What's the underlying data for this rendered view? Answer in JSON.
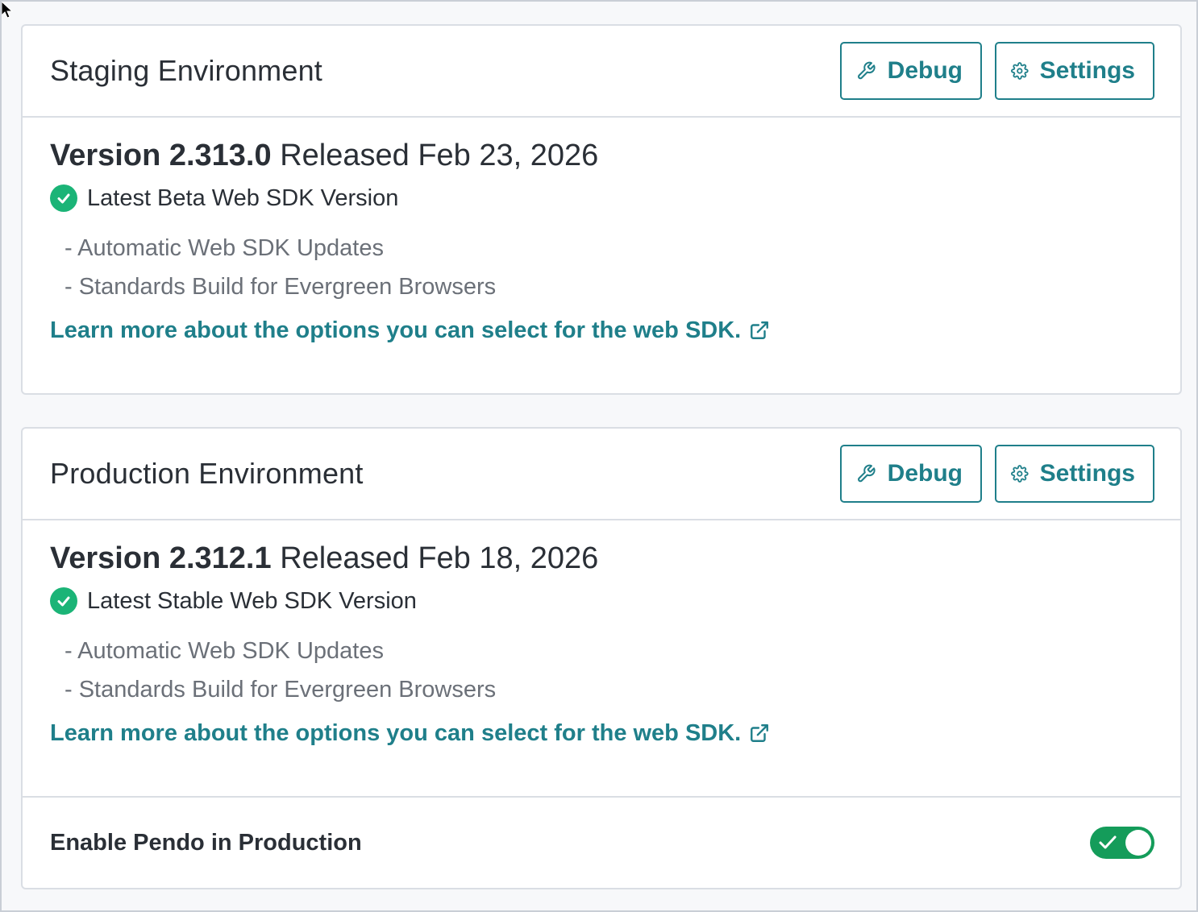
{
  "colors": {
    "accent": "#1f7f8a",
    "success": "#1bb477",
    "toggle_on": "#149c5a",
    "text_primary": "#2a2f36",
    "text_muted": "#6b7078"
  },
  "staging": {
    "title": "Staging Environment",
    "debug_label": "Debug",
    "settings_label": "Settings",
    "version": "Version 2.313.0",
    "released": "Released Feb 23, 2026",
    "status": "Latest Beta Web SDK Version",
    "features": [
      "- Automatic Web SDK Updates",
      "- Standards Build for Evergreen Browsers"
    ],
    "learn_more": "Learn more about the options you can select for the web SDK."
  },
  "production": {
    "title": "Production Environment",
    "debug_label": "Debug",
    "settings_label": "Settings",
    "version": "Version 2.312.1",
    "released": "Released Feb 18, 2026",
    "status": "Latest Stable Web SDK Version",
    "features": [
      "- Automatic Web SDK Updates",
      "- Standards Build for Evergreen Browsers"
    ],
    "learn_more": "Learn more about the options you can select for the web SDK.",
    "enable_label": "Enable Pendo in Production",
    "enabled": true
  },
  "icons": {
    "debug": "wrench-icon",
    "settings": "gear-icon",
    "status": "check-circle-icon",
    "external": "external-link-icon",
    "toggle": "check-icon"
  }
}
